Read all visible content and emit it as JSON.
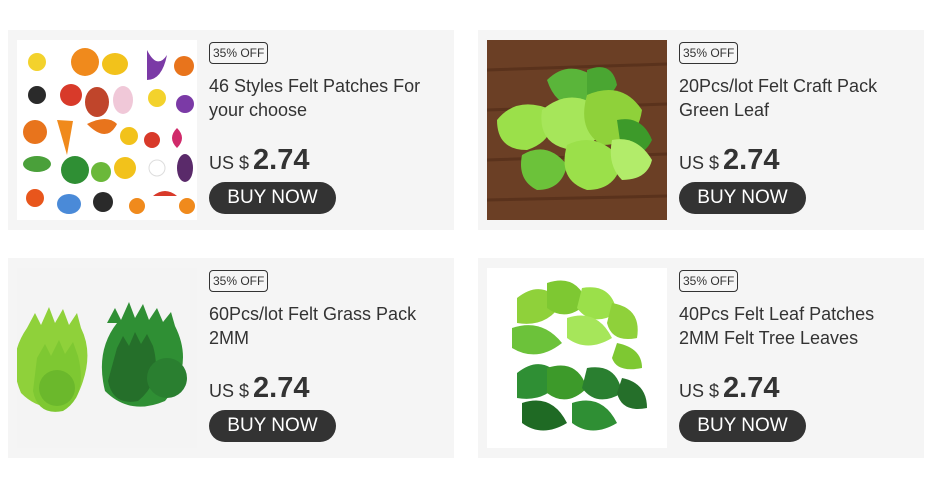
{
  "products": [
    {
      "badge": "35% OFF",
      "title": "46 Styles Felt Patches For your choose",
      "currency": "US $",
      "price": "2.74",
      "button": "BUY NOW",
      "image": "felt-animals-fruits-image"
    },
    {
      "badge": "35% OFF",
      "title": "20Pcs/lot Felt Craft Pack Green Leaf",
      "currency": "US $",
      "price": "2.74",
      "button": "BUY NOW",
      "image": "felt-green-leaves-wood-image"
    },
    {
      "badge": "35% OFF",
      "title": "60Pcs/lot Felt Grass Pack 2MM",
      "currency": "US $",
      "price": "2.74",
      "button": "BUY NOW",
      "image": "felt-grass-image"
    },
    {
      "badge": "35% OFF",
      "title": "40Pcs Felt Leaf Patches 2MM Felt Tree Leaves",
      "currency": "US $",
      "price": "2.74",
      "button": "BUY NOW",
      "image": "felt-tree-leaves-image"
    }
  ],
  "colors": {
    "card_bg": "#f5f5f5",
    "button_bg": "#333333",
    "text": "#333333",
    "light_green": "#8fd13a",
    "dark_green": "#2f8f34",
    "wood": "#6b3f25"
  }
}
